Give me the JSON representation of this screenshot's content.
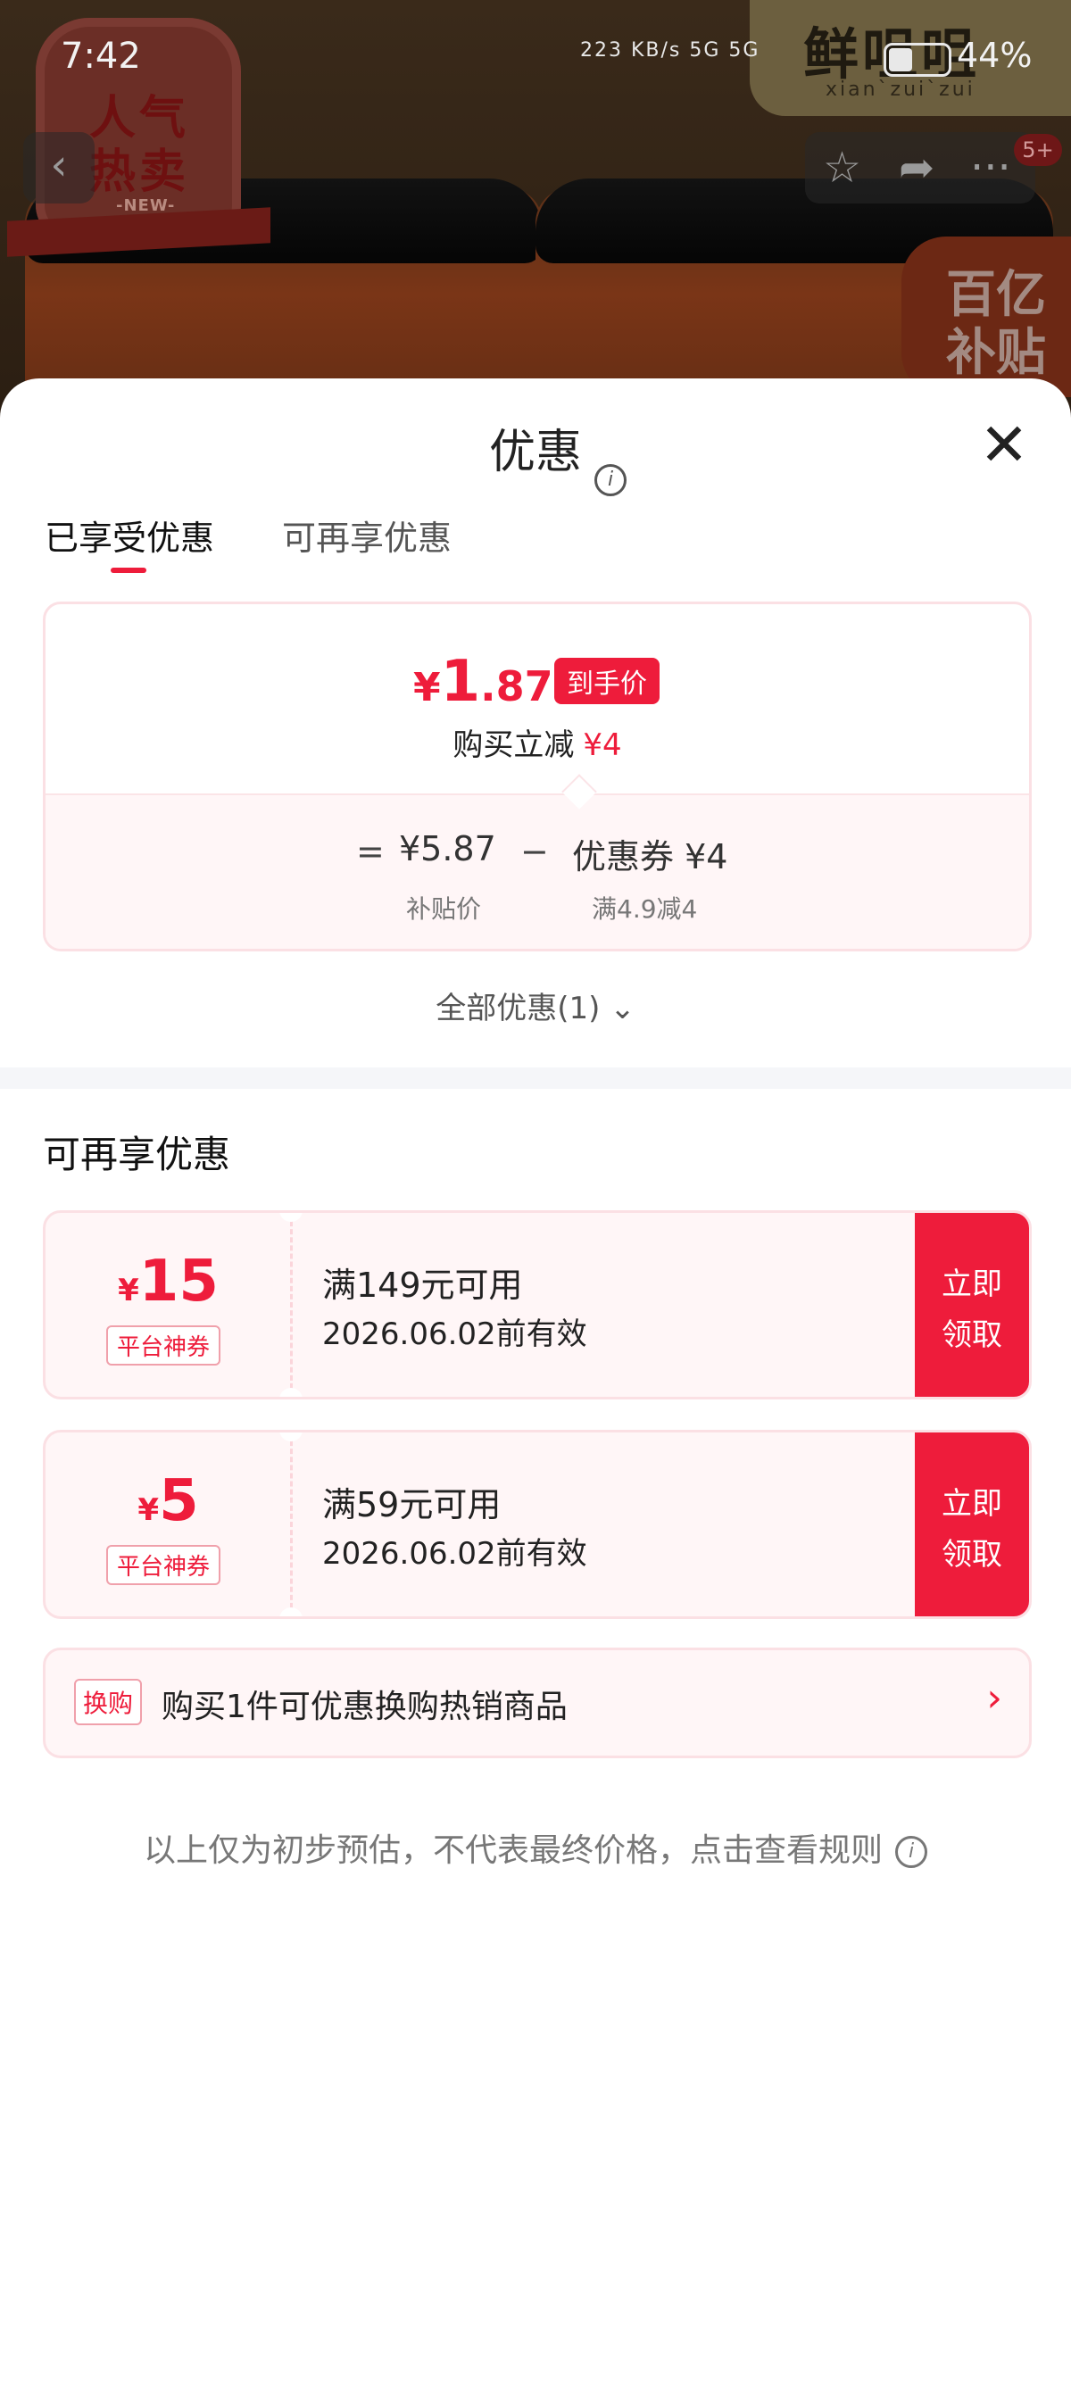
{
  "status_bar": {
    "time": "7:42",
    "net_speed": "223 KB/s",
    "signal": "5G 5G",
    "battery": "44%"
  },
  "hero": {
    "badge_line1": "人气",
    "badge_line2": "热卖",
    "badge_new": "-NEW-",
    "brand_sub": "xian`zui`zui",
    "subsidy_line1": "百亿",
    "subsidy_line2": "补贴",
    "more_badge": "5+"
  },
  "sheet": {
    "title": "优惠",
    "tabs": [
      "已享受优惠",
      "可再享优惠"
    ],
    "price": {
      "yen": "¥",
      "int": "1",
      "dec": ".87",
      "tag": "到手价",
      "save_label": "购买立减",
      "save_amount": "¥4",
      "eq": "=",
      "subsidy_price": "¥5.87",
      "minus": "−",
      "coupon_value": "优惠券 ¥4",
      "subsidy_label": "补贴价",
      "coupon_label": "满4.9减4"
    },
    "all_discounts": "全部优惠(1)",
    "section_title": "可再享优惠",
    "coupons": [
      {
        "yen": "¥",
        "value": "15",
        "type": "平台神券",
        "condition": "满149元可用",
        "expiry": "2026.06.02前有效",
        "claim1": "立即",
        "claim2": "领取"
      },
      {
        "yen": "¥",
        "value": "5",
        "type": "平台神券",
        "condition": "满59元可用",
        "expiry": "2026.06.02前有效",
        "claim1": "立即",
        "claim2": "领取"
      }
    ],
    "swap": {
      "tag": "换购",
      "text": "购买1件可优惠换购热销商品"
    },
    "disclaimer": "以上仅为初步预估，不代表最终价格，点击查看规则"
  },
  "colors": {
    "accent": "#ee1c3b",
    "card_border": "#fbe0e4",
    "card_bg": "#fff6f7"
  }
}
